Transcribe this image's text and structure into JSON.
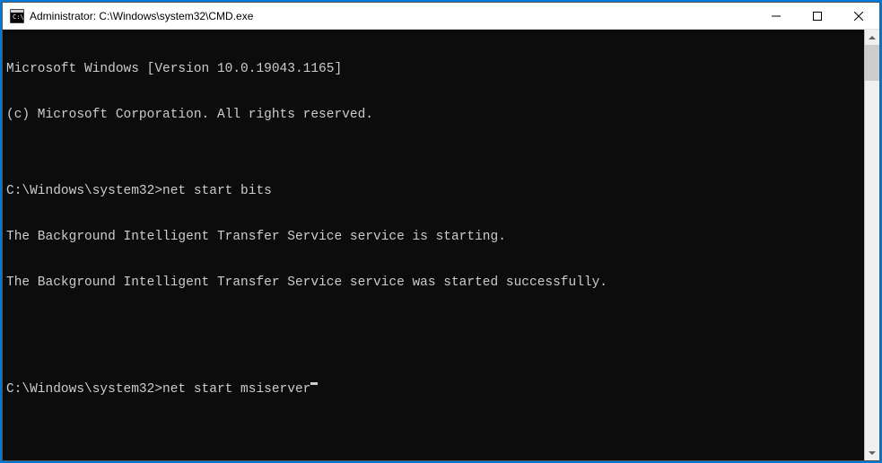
{
  "titlebar": {
    "title": "Administrator: C:\\Windows\\system32\\CMD.exe"
  },
  "terminal": {
    "lines": [
      "Microsoft Windows [Version 10.0.19043.1165]",
      "(c) Microsoft Corporation. All rights reserved.",
      "",
      "C:\\Windows\\system32>net start bits",
      "The Background Intelligent Transfer Service service is starting.",
      "The Background Intelligent Transfer Service service was started successfully.",
      "",
      ""
    ],
    "current_prompt": "C:\\Windows\\system32>",
    "current_input": "net start msiserver"
  }
}
